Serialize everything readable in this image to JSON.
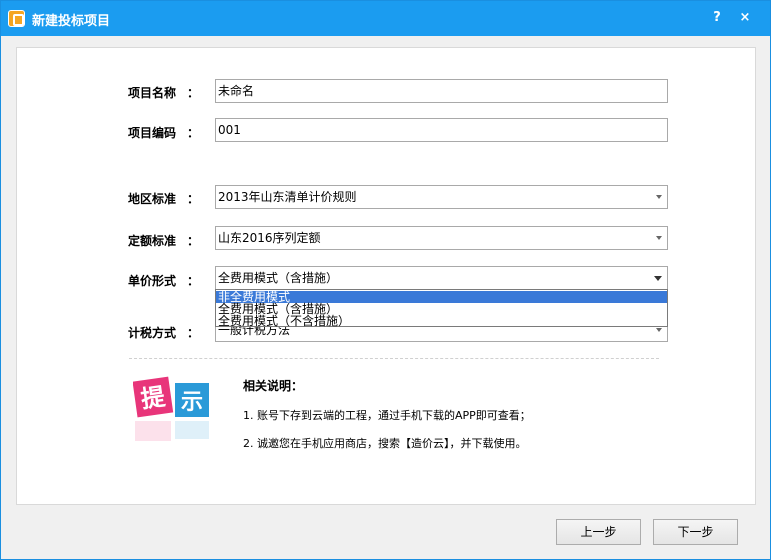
{
  "window": {
    "title": "新建投标项目",
    "help_label": "?",
    "close_label": "×"
  },
  "form": {
    "project_name": {
      "label": "项目名称",
      "colon": "：",
      "value": "未命名"
    },
    "project_code": {
      "label": "项目编码",
      "colon": "：",
      "value": "001"
    },
    "region_standard": {
      "label": "地区标准",
      "colon": "：",
      "value": "2013年山东清单计价规则"
    },
    "quota_standard": {
      "label": "定额标准",
      "colon": "：",
      "value": "山东2016序列定额"
    },
    "unit_price_form": {
      "label": "单价形式",
      "colon": "：",
      "value": "全费用模式（含措施）",
      "options": [
        "非全费用模式",
        "全费用模式（含措施）",
        "全费用模式（不含措施）"
      ],
      "highlighted_index": 0
    },
    "tax_method": {
      "label": "计税方式",
      "colon": "：",
      "value": "一般计税方法"
    }
  },
  "tips": {
    "logo_text_1": "提",
    "logo_text_2": "示",
    "title": "相关说明：",
    "line1": "1. 账号下存到云端的工程，通过手机下载的APP即可查看；",
    "line2": "2. 诚邀您在手机应用商店，搜索【造价云】，并下载使用。"
  },
  "buttons": {
    "prev": "上一步",
    "next": "下一步"
  },
  "colors": {
    "titlebar": "#1b9cf0",
    "highlight": "#3a79d8",
    "tip_pink": "#e8357a",
    "tip_blue": "#2a9ad8"
  }
}
